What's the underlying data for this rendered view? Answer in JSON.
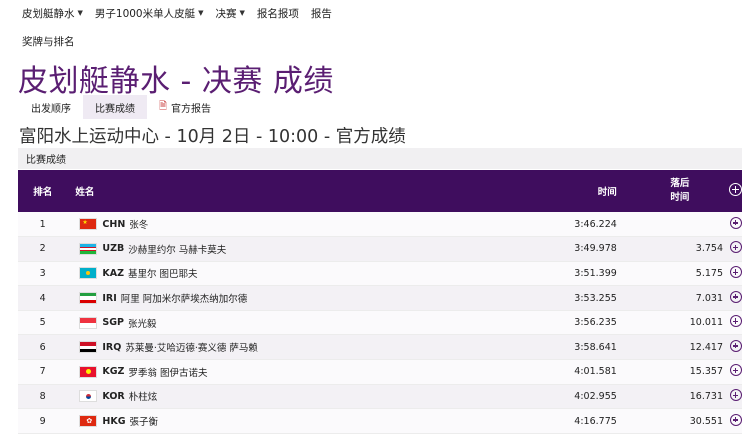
{
  "nav": {
    "items": [
      {
        "label": "皮划艇静水",
        "dropdown": true
      },
      {
        "label": "男子1000米单人皮艇",
        "dropdown": true
      },
      {
        "label": "决赛",
        "dropdown": true
      },
      {
        "label": "报名报项",
        "dropdown": false
      },
      {
        "label": "报告",
        "dropdown": false
      }
    ],
    "sub": "奖牌与排名"
  },
  "page_title": "皮划艇静水 - 决赛 成绩",
  "tabs": [
    {
      "label": "出发顺序"
    },
    {
      "label": "比赛成绩",
      "active": true
    },
    {
      "label": "官方报告",
      "icon": "pdf-icon"
    }
  ],
  "subtitle": "富阳水上运动中心 - 10月 2日 - 10:00 - 官方成绩",
  "section_title": "比赛成绩",
  "table": {
    "headers": {
      "rank": "排名",
      "name": "姓名",
      "time": "时间",
      "behind_1": "落后",
      "behind_2": "时间"
    },
    "header_color": "#3f0d5e",
    "rows": [
      {
        "rank": "1",
        "noc": "CHN",
        "name": "张冬",
        "time": "3:46.224",
        "behind": ""
      },
      {
        "rank": "2",
        "noc": "UZB",
        "name": "沙赫里约尔 马赫卡莫夫",
        "time": "3:49.978",
        "behind": "3.754"
      },
      {
        "rank": "3",
        "noc": "KAZ",
        "name": "基里尔 图巴耶夫",
        "time": "3:51.399",
        "behind": "5.175"
      },
      {
        "rank": "4",
        "noc": "IRI",
        "name": "阿里 阿加米尔萨埃杰纳加尔德",
        "time": "3:53.255",
        "behind": "7.031"
      },
      {
        "rank": "5",
        "noc": "SGP",
        "name": "张光毅",
        "time": "3:56.235",
        "behind": "10.011"
      },
      {
        "rank": "6",
        "noc": "IRQ",
        "name": "苏莱曼·艾哈迈德·赛义德 萨马赖",
        "time": "3:58.641",
        "behind": "12.417"
      },
      {
        "rank": "7",
        "noc": "KGZ",
        "name": "罗季翁 图伊古诺夫",
        "time": "4:01.581",
        "behind": "15.357"
      },
      {
        "rank": "8",
        "noc": "KOR",
        "name": "朴柱炫",
        "time": "4:02.955",
        "behind": "16.731"
      },
      {
        "rank": "9",
        "noc": "HKG",
        "name": "張子衡",
        "time": "4:16.775",
        "behind": "30.551"
      }
    ]
  }
}
